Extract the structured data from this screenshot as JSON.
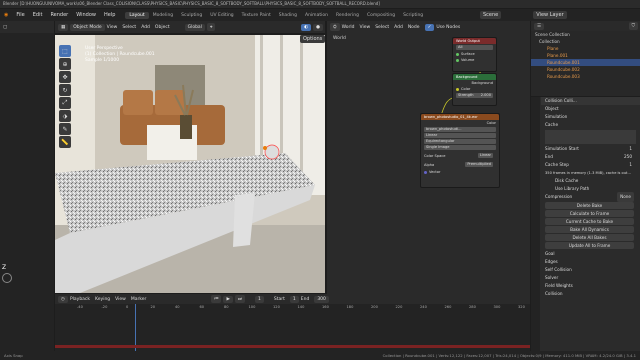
{
  "title_bar": "Blender [D:\\HUONGUUNIVOMA_work\\s06_Blender Class_COLISION\\CLASS\\PHYSICS_BASIC\\PHYSICS_BASIC_8_SOFTBODY_SOFTBALL\\PHYSICS_BASIC_8_SOFTBODY_SOFTBALL_RECORD.blend]",
  "menu": [
    "File",
    "Edit",
    "Render",
    "Window",
    "Help"
  ],
  "workspaces": [
    "Layout",
    "Modeling",
    "Sculpting",
    "UV Editing",
    "Texture Paint",
    "Shading",
    "Animation",
    "Rendering",
    "Compositing",
    "Scripting"
  ],
  "scene": "Scene",
  "view_layer": "View Layer",
  "viewport": {
    "mode": "Object Mode",
    "menus": [
      "View",
      "Select",
      "Add",
      "Object"
    ],
    "transform": "Global",
    "options": "Options",
    "info": [
      "User Perspective",
      "(1) Collection | Roundcube.001",
      "Sample 1/1000"
    ]
  },
  "tools": [
    "cursor-select",
    "cursor",
    "move",
    "rotate",
    "scale",
    "transform",
    "annotate",
    "measure"
  ],
  "node_editor": {
    "type": "World",
    "menus": [
      "View",
      "Select",
      "Add",
      "Node"
    ],
    "use_nodes": "Use Nodes",
    "slot": "World",
    "world_output": {
      "title": "World Output",
      "target": "All",
      "sockets": [
        "Surface",
        "Volume"
      ]
    },
    "background": {
      "title": "Background",
      "sockets": [
        "Background",
        "Color"
      ],
      "strength_label": "Strength",
      "strength": "2.000"
    },
    "env_texture": {
      "title": "brown_photostudio_01_4k.exr",
      "output": "Color",
      "image": "brown_photostudi...",
      "options": [
        "Linear",
        "Equirectangular",
        "Single Image"
      ],
      "color_space_label": "Color Space",
      "color_space": "Linear",
      "alpha_label": "Alpha",
      "alpha": "Premultiplied",
      "vector": "Vector"
    }
  },
  "outliner": {
    "root": "Scene Collection",
    "items": [
      "Collection",
      "Plane",
      "Plane.001",
      "Roundcube.001",
      "Roundcube.002",
      "Roundcube.003"
    ]
  },
  "properties": {
    "object": "Collision Colli...",
    "sections": [
      "Object",
      "Simulation",
      "Cache"
    ],
    "cache": {
      "sim_start_label": "Simulation Start",
      "sim_start": "1",
      "end_label": "End",
      "end": "250",
      "step_label": "Cache Step",
      "step": "1"
    },
    "info_line": "350 frames in memory (1.3 MiB), cache is out...",
    "checks": [
      "Disk Cache",
      "Use Library Path"
    ],
    "compression_label": "Compression",
    "compression": "None",
    "buttons": [
      "Delete Bake",
      "Calculate to Frame",
      "Current Cache to Bake",
      "Bake All Dynamics",
      "Delete All Bakes",
      "Update All to Frame"
    ],
    "subsections": [
      "Goal",
      "Edges",
      "Self Collision",
      "Solver",
      "Field Weights"
    ],
    "collision": "Collision"
  },
  "timeline": {
    "menus": [
      "Playback",
      "Keying",
      "View",
      "Marker"
    ],
    "current": "1",
    "start_label": "Start",
    "start": "1",
    "end_label": "End",
    "end": "300",
    "ticks": [
      "-40",
      "-20",
      "0",
      "20",
      "40",
      "60",
      "80",
      "100",
      "120",
      "140",
      "160",
      "180",
      "200",
      "220",
      "240",
      "260",
      "280",
      "300",
      "320"
    ]
  },
  "status": {
    "left": "Axis Snap",
    "right": "Collection | Roundcube.001 | Verts:12,122 | Faces:12,007 | Tris:24,014 | Objects:0/9 | Memory: 411.0 MiB | VRAM: 4.2/24.0 GiB | 3.4.1"
  }
}
